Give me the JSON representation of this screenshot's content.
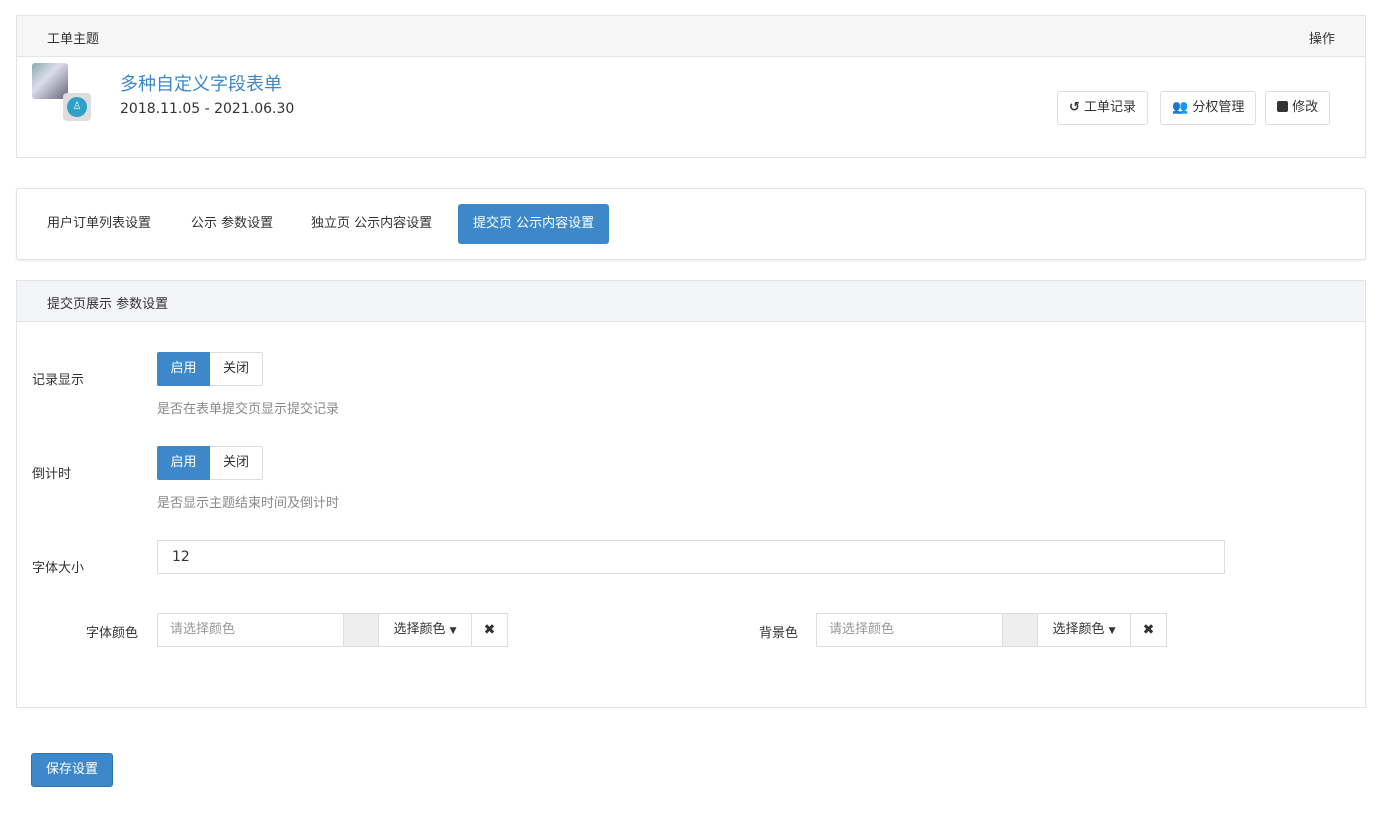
{
  "header": {
    "col_subject": "工单主题",
    "col_actions": "操作"
  },
  "ticket": {
    "title": "多种自定义字段表单",
    "date_range": "2018.11.05 - 2021.06.30"
  },
  "actions": [
    {
      "label": "工单记录",
      "icon": "history-icon"
    },
    {
      "label": "分权管理",
      "icon": "users-icon"
    },
    {
      "label": "修改",
      "icon": "edit-icon"
    }
  ],
  "tabs": [
    {
      "label": "用户订单列表设置"
    },
    {
      "label": "公示 参数设置"
    },
    {
      "label": "独立页 公示内容设置"
    },
    {
      "label": "提交页 公示内容设置",
      "active": true
    }
  ],
  "section": {
    "title": "提交页展示 参数设置"
  },
  "form": {
    "record_display": {
      "label": "记录显示",
      "on": "启用",
      "off": "关闭",
      "selected": "启用",
      "help": "是否在表单提交页显示提交记录"
    },
    "countdown": {
      "label": "倒计时",
      "on": "启用",
      "off": "关闭",
      "selected": "启用",
      "help": "是否显示主题结束时间及倒计时"
    },
    "font_size": {
      "label": "字体大小",
      "value": "12"
    },
    "font_color": {
      "label": "字体颜色",
      "placeholder": "请选择颜色",
      "picker": "选择颜色"
    },
    "bg_color": {
      "label": "背景色",
      "placeholder": "请选择颜色",
      "picker": "选择颜色"
    }
  },
  "save_label": "保存设置",
  "colors": {
    "accent": "#3d88c9"
  }
}
